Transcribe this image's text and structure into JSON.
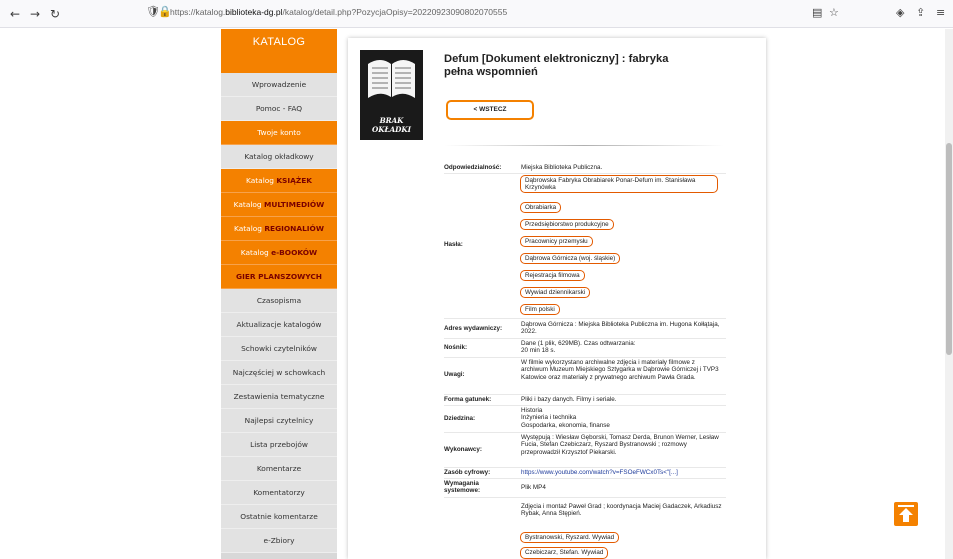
{
  "browser": {
    "nav_back": "←",
    "nav_forward": "→",
    "nav_reload": "↻",
    "url_prefix": "https://katalog.",
    "url_domain": "biblioteka-dg.pl",
    "url_rest": "/katalog/detail.php?PozycjaOpisy=20220923090802070555",
    "reader_icon": "reader-icon",
    "bookmark_icon": "star-icon",
    "pocket_icon": "shield-icon",
    "extensions_icon": "puzzle-icon",
    "menu_icon": "menu-icon"
  },
  "sidebar": {
    "logo": "KATALOG",
    "items": [
      {
        "label": "Wprowadzenie",
        "highlight": ""
      },
      {
        "label": "Pomoc - FAQ",
        "highlight": ""
      },
      {
        "label": "Twoje konto",
        "highlight": ""
      },
      {
        "label": "Katalog okładkowy",
        "highlight": ""
      },
      {
        "label": "Katalog ",
        "highlight": "KSIĄŻEK"
      },
      {
        "label": "Katalog ",
        "highlight": "MULTIMEDIÓW"
      },
      {
        "label": "Katalog ",
        "highlight": "REGIONALIÓW"
      },
      {
        "label": "Katalog ",
        "highlight": "e-BOOKÓW"
      },
      {
        "label": "",
        "highlight": "GIER PLANSZOWYCH"
      },
      {
        "label": "Czasopisma",
        "highlight": ""
      },
      {
        "label": "Aktualizacje katalogów",
        "highlight": ""
      },
      {
        "label": "Schowki czytelników",
        "highlight": ""
      },
      {
        "label": "Najczęściej w schowkach",
        "highlight": ""
      },
      {
        "label": "Zestawienia tematyczne",
        "highlight": ""
      },
      {
        "label": "Najlepsi czytelnicy",
        "highlight": ""
      },
      {
        "label": "Lista przebojów",
        "highlight": ""
      },
      {
        "label": "Komentarze",
        "highlight": ""
      },
      {
        "label": "Komentatorzy",
        "highlight": ""
      },
      {
        "label": "Ostatnie komentarze",
        "highlight": ""
      },
      {
        "label": "e-Zbiory",
        "highlight": ""
      }
    ]
  },
  "record": {
    "cover_text": "BRAK OKŁADKI",
    "title": "Defum [Dokument elektroniczny] : fabryka pełna wspomnień",
    "back_label": "< WSTECZ",
    "fields": {
      "odpowiedzialnosc_label": "Odpowiedzialność:",
      "odpowiedzialnosc_value": "Miejska Biblioteka Publiczna.",
      "hasla_label": "Hasła:",
      "hasla": [
        "Dąbrowska Fabryka Obrabiarek Ponar-Defum im. Stanisława Krzynówka",
        "Obrabiarka",
        "Przedsiębiorstwo produkcyjne",
        "Pracownicy przemysłu",
        "Dąbrowa Górnicza (woj. śląskie)",
        "Rejestracja filmowa",
        "Wywiad dziennikarski",
        "Film polski"
      ],
      "adres_label": "Adres wydawniczy:",
      "adres_value": "Dąbrowa Górnicza : Miejska Biblioteka Publiczna im. Hugona Kołłątaja, 2022.",
      "nosnik_label": "Nośnik:",
      "nosnik_value": "Dane (1 plik, 629MB). Czas odtwarzania: 20 min 18 s.",
      "uwagi_label": "Uwagi:",
      "uwagi_value": "W filmie wykorzystano archiwalne zdjęcia i materiały filmowe z archiwum Muzeum Miejskiego Sztygarka w Dąbrowie Górniczej i TVP3 Katowice oraz materiały z prywatnego archiwum Pawła Grada.",
      "forma_label": "Forma gatunek:",
      "forma_value": "Pliki i bazy danych. Filmy i seriale.",
      "dziedzina_label": "Dziedzina:",
      "dziedzina_values": [
        "Historia",
        "Inżynieria i technika",
        "Gospodarka, ekonomia, finanse"
      ],
      "wykonawcy_label": "Wykonawcy:",
      "wykonawcy_value": "Występują : Wiesław Gęborski, Tomasz Derda, Brunon Werner, Lesław Fucia, Stefan Czebiczarz, Ryszard Bystranowski ; rozmowy przeprowadził Krzysztof Piekarski.",
      "zasob_label": "Zasób cyfrowy:",
      "zasob_value": "https://www.youtube.com/watch?v=FSOeFWCx0Ts<\"[...]",
      "wymagania_label": "Wymagania systemowe:",
      "wymagania_value": "Plik MP4",
      "credits_value": "Zdjęcia i montaż Paweł Grad ; koordynacja Maciej Gadaczek, Arkadiusz Rybak, Anna Stępień.",
      "people_tags": [
        "Bystranowski, Ryszard. Wywiad",
        "Czebiczarz, Stefan. Wywiad"
      ]
    }
  },
  "colors": {
    "accent": "#f48100",
    "tag_border": "#e35a00",
    "link": "#1f3c9c"
  }
}
